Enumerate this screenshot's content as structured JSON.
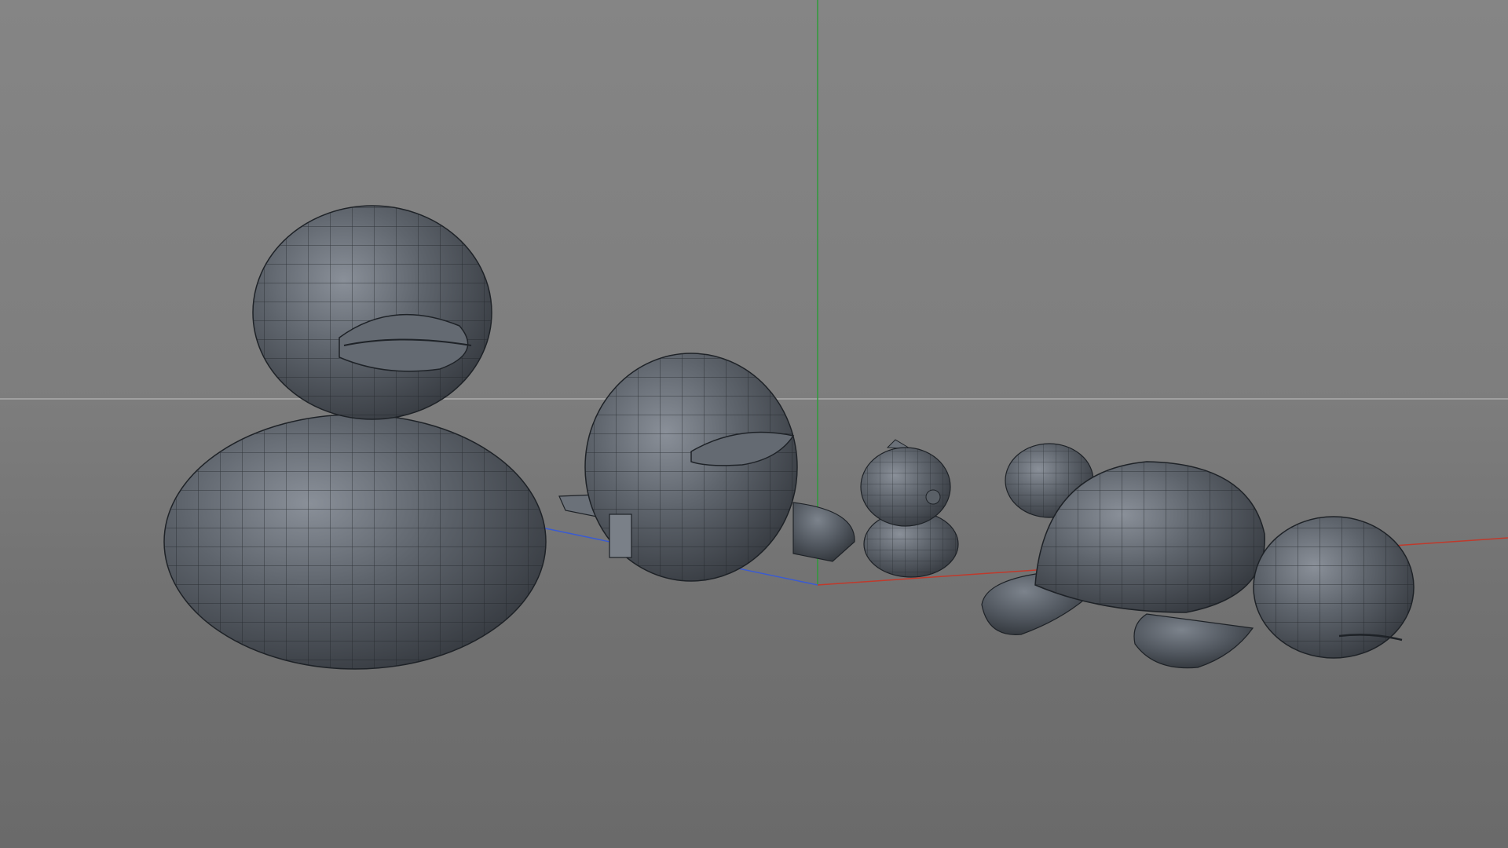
{
  "viewport": {
    "background_color": "#7f7f7f",
    "mesh_fill_color": "#5c6168",
    "wire_color": "#1f2328",
    "axis_x_color": "#c0392b",
    "axis_y_color": "#2e9b3a",
    "axis_z_color": "#3b5bd1",
    "horizon_color": "#b8b8b8",
    "objects": [
      {
        "id": "duck",
        "icon": "duck-mesh"
      },
      {
        "id": "penguin",
        "icon": "penguin-mesh"
      },
      {
        "id": "seahorse",
        "icon": "small-figure-mesh"
      },
      {
        "id": "turtle",
        "icon": "turtle-mesh"
      }
    ]
  }
}
